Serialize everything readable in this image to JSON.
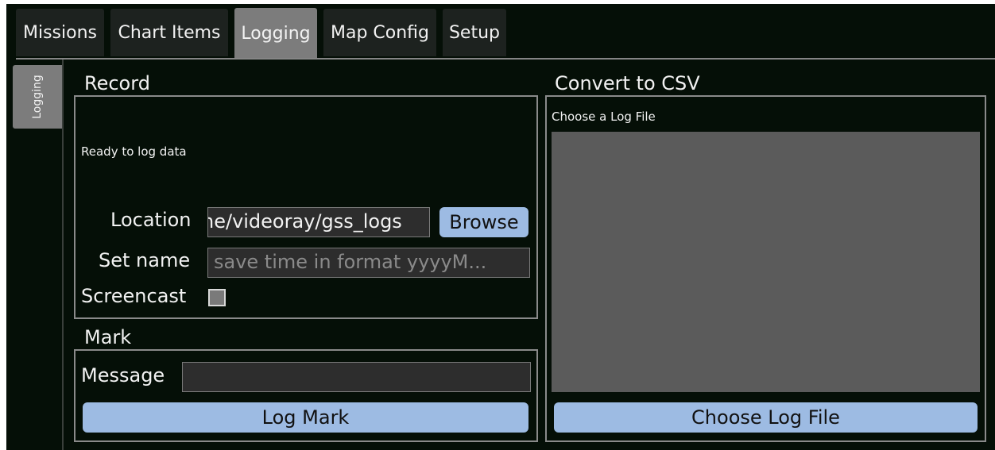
{
  "tabs": [
    {
      "label": "Missions"
    },
    {
      "label": "Chart Items"
    },
    {
      "label": "Logging"
    },
    {
      "label": "Map Config"
    },
    {
      "label": "Setup"
    }
  ],
  "active_tab": "Logging",
  "side_tab": {
    "label": "Logging"
  },
  "record": {
    "title": "Record",
    "status": "Ready to log data",
    "location_label": "Location",
    "location_value": "ne/videoray/gss_logs",
    "browse_label": "Browse",
    "set_name_label": "Set name",
    "set_name_placeholder": "save time in format yyyyM...",
    "screencast_label": "Screencast",
    "screencast_checked": false
  },
  "mark": {
    "title": "Mark",
    "message_label": "Message",
    "message_value": "",
    "log_mark_label": "Log Mark"
  },
  "convert": {
    "title": "Convert to CSV",
    "choose_prompt": "Choose a Log File",
    "choose_button_label": "Choose Log File"
  },
  "colors": {
    "background": "#050f07",
    "button": "#9dbbe3",
    "active_tab": "#7c7c7c",
    "listbox": "#5b5b5b"
  }
}
